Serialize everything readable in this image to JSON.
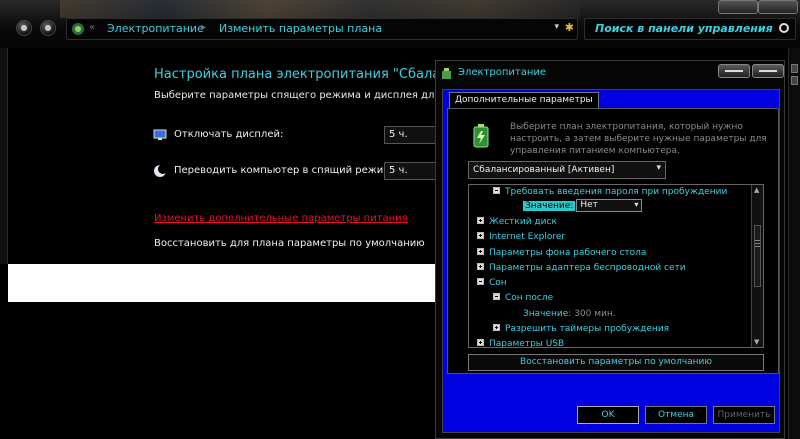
{
  "breadcrumb": {
    "root_sep": "«",
    "item1": "Электропитание",
    "sep": "▸",
    "item2": "Изменить параметры плана"
  },
  "search": {
    "placeholder": "Поиск в панели управления"
  },
  "page": {
    "title": "Настройка плана электропитания \"Сбаланси",
    "subtitle": "Выберите параметры спящего режима и дисплея для этого",
    "display_off_label": "Отключать дисплей:",
    "display_off_value": "5 ч.",
    "sleep_label": "Переводить компьютер в спящий режим:",
    "sleep_value": "5 ч.",
    "advanced_link": "Изменить дополнительные параметры питания",
    "restore_defaults": "Восстановить для плана параметры по умолчанию"
  },
  "dialog": {
    "title": "Электропитание",
    "tab": "Дополнительные параметры",
    "description": "Выберите план электропитания, который нужно настроить, а затем выберите нужные параметры для управления питанием компьютера.",
    "plan": "Сбалансированный [Активен]",
    "tree": [
      {
        "label": "Требовать введения пароля при пробуждении",
        "state": "minus"
      },
      {
        "label": "Значение:",
        "value": "Нет"
      },
      {
        "label": "Жесткий диск",
        "state": "plus"
      },
      {
        "label": "Internet Explorer",
        "state": "plus"
      },
      {
        "label": "Параметры фона рабочего стола",
        "state": "plus"
      },
      {
        "label": "Параметры адаптера беспроводной сети",
        "state": "plus"
      },
      {
        "label": "Сон",
        "state": "minus"
      },
      {
        "label": "Сон после",
        "state": "minus"
      },
      {
        "label": "Значение:",
        "value": "300 мин."
      },
      {
        "label": "Разрешить таймеры пробуждения",
        "state": "plus"
      },
      {
        "label": "Параметры USB",
        "state": "plus"
      }
    ],
    "restore_button": "Восстановить параметры по умолчанию",
    "ok": "OK",
    "cancel": "Отмена",
    "apply": "Применить"
  },
  "colors": {
    "accent": "#3cd0e0",
    "link": "#e8102a",
    "dialog_frame": "#0000e0",
    "value_highlight": "#2bc9c9"
  }
}
